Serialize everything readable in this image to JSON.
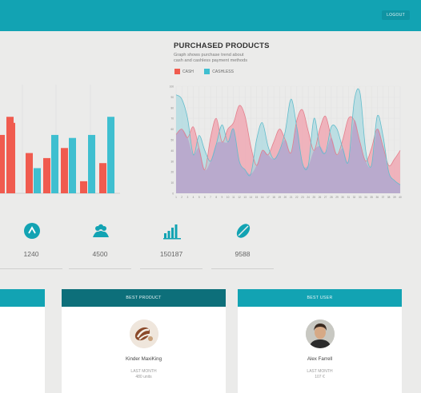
{
  "header": {
    "button_label": "LOGOUT"
  },
  "line_chart": {
    "title": "PURCHASED PRODUCTS",
    "subtitle_line1": "Graph shows purchase trend about",
    "subtitle_line2": "cash and cashless payment methods",
    "legend": [
      {
        "label": "CASH",
        "color": "#f05b4f"
      },
      {
        "label": "CASHLESS",
        "color": "#3fbfd0"
      }
    ]
  },
  "stats": [
    {
      "icon": "arrow-up-icon",
      "value": "1240"
    },
    {
      "icon": "users-icon",
      "value": "4500"
    },
    {
      "icon": "bar-chart-icon",
      "value": "150187"
    },
    {
      "icon": "coffee-bean-icon",
      "value": "9588"
    }
  ],
  "cards": {
    "best_product": {
      "title": "BEST PRODUCT",
      "name": "Kinder MaxiKing",
      "meta_line1": "LAST MONTH",
      "meta_line2": "480 units"
    },
    "best_user": {
      "title": "BEST USER",
      "name": "Alex Farrell",
      "meta_line1": "LAST MONTH",
      "meta_line2": "107 €"
    }
  },
  "colors": {
    "teal": "#12a3b3",
    "dark_teal": "#0d6f7a",
    "orange": "#f05b4f",
    "cyan": "#3fbfd0",
    "pink_fill": "#f0a9b4",
    "blue_fill": "#a8d8df",
    "purple_fill": "#b8a6cc"
  },
  "chart_data": [
    {
      "type": "bar",
      "title": "",
      "categories": [
        "",
        "",
        "",
        "",
        "",
        ""
      ],
      "series": [
        {
          "name": "",
          "values": [
            0.7,
            0.4,
            0.35,
            0.45,
            0.12,
            0.3
          ]
        },
        {
          "name": "",
          "values": [
            0.25,
            0.25,
            0.58,
            0.55,
            0.58,
            0.76
          ]
        }
      ],
      "first_group_extra": [
        0.58,
        0.76
      ],
      "ylim": [
        0,
        1
      ]
    },
    {
      "type": "area",
      "title": "PURCHASED PRODUCTS",
      "xlabel": "",
      "ylabel": "",
      "x": [
        1,
        2,
        3,
        4,
        5,
        6,
        7,
        8,
        9,
        10,
        11,
        12,
        13,
        14,
        15,
        16,
        17,
        18,
        19,
        20,
        21,
        22,
        23,
        24,
        25,
        26,
        27,
        28,
        29,
        30,
        31,
        32,
        33,
        34,
        35,
        36,
        37,
        38,
        39,
        40
      ],
      "series": [
        {
          "name": "CASH",
          "values": [
            55,
            60,
            52,
            62,
            42,
            22,
            52,
            70,
            48,
            60,
            66,
            82,
            72,
            44,
            26,
            40,
            36,
            48,
            60,
            50,
            38,
            68,
            78,
            58,
            40,
            60,
            72,
            52,
            36,
            50,
            70,
            68,
            48,
            30,
            42,
            60,
            44,
            26,
            32,
            40
          ]
        },
        {
          "name": "CASHLESS",
          "values": [
            92,
            88,
            70,
            36,
            54,
            40,
            30,
            46,
            64,
            48,
            60,
            30,
            22,
            18,
            50,
            66,
            44,
            32,
            40,
            58,
            88,
            62,
            28,
            26,
            70,
            44,
            38,
            62,
            60,
            42,
            30,
            86,
            94,
            40,
            26,
            72,
            54,
            20,
            12,
            8
          ]
        }
      ],
      "ylim": [
        0,
        100
      ]
    }
  ]
}
